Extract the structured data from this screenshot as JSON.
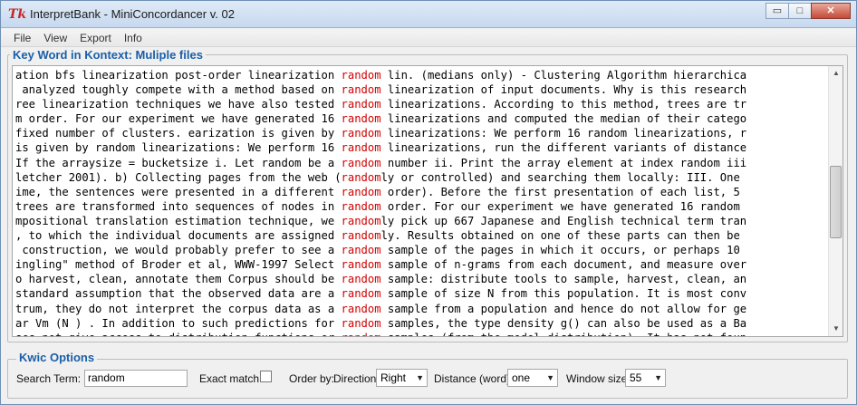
{
  "window": {
    "title": "InterpretBank - MiniConcordancer v. 02",
    "app_icon_glyph": "Tk",
    "controls": {
      "minimize": "▭",
      "maximize": "□",
      "close": "✕"
    }
  },
  "menu": [
    "File",
    "View",
    "Export",
    "Info"
  ],
  "kwic": {
    "title": "Key Word in Kontext: Muliple files",
    "keyword": "random",
    "lines": [
      {
        "left": "ation bfs linearization post-order linearization ",
        "kw": "random",
        "right": " lin. (medians only) - Clustering Algorithm hierarchica"
      },
      {
        "left": " analyzed toughly compete with a method based on ",
        "kw": "random",
        "right": " linearization of input documents. Why is this research"
      },
      {
        "left": "ree linearization techniques we have also tested ",
        "kw": "random",
        "right": " linearizations. According to this method, trees are tr"
      },
      {
        "left": "m order. For our experiment we have generated 16 ",
        "kw": "random",
        "right": " linearizations and computed the median of their catego"
      },
      {
        "left": "fixed number of clusters. earization is given by ",
        "kw": "random",
        "right": " linearizations: We perform 16 random linearizations, r"
      },
      {
        "left": "is given by random linearizations: We perform 16 ",
        "kw": "random",
        "right": " linearizations, run the different variants of distance"
      },
      {
        "left": "If the arraysize = bucketsize i. Let random be a ",
        "kw": "random",
        "right": " number ii. Print the array element at index random iii"
      },
      {
        "left": "letcher 2001). b) Collecting pages from the web (",
        "kw": "random",
        "right": "ly or controlled) and searching them locally: III. One"
      },
      {
        "left": "ime, the sentences were presented in a different ",
        "kw": "random",
        "right": " order). Before the first presentation of each list, 5"
      },
      {
        "left": "trees are transformed into sequences of nodes in ",
        "kw": "random",
        "right": " order. For our experiment we have generated 16 random"
      },
      {
        "left": "mpositional translation estimation technique, we ",
        "kw": "random",
        "right": "ly pick up 667 Japanese and English technical term tran"
      },
      {
        "left": ", to which the individual documents are assigned ",
        "kw": "random",
        "right": "ly. Results obtained on one of these parts can then be"
      },
      {
        "left": " construction, we would probably prefer to see a ",
        "kw": "random",
        "right": " sample of the pages in which it occurs, or perhaps 10"
      },
      {
        "left": "ingling\" method of Broder et al, WWW-1997 Select ",
        "kw": "random",
        "right": " sample of n-grams from each document, and measure over"
      },
      {
        "left": "o harvest, clean, annotate them Corpus should be ",
        "kw": "random",
        "right": " sample: distribute tools to sample, harvest, clean, an"
      },
      {
        "left": "standard assumption that the observed data are a ",
        "kw": "random",
        "right": " sample of size N from this population. It is most conv"
      },
      {
        "left": "trum, they do not interpret the corpus data as a ",
        "kw": "random",
        "right": " sample from a population and hence do not allow for ge"
      },
      {
        "left": "ar Vm (N ) . In addition to such predictions for ",
        "kw": "random",
        "right": " samples, the type density g() can also be used as a Ba"
      },
      {
        "left": "ses not give access to distribution functions or ",
        "kw": "random",
        "right": " samples (from the model distribution). It has not foun"
      }
    ],
    "scrollbar": {
      "up": "▲",
      "down": "▼"
    }
  },
  "options": {
    "title": "Kwic Options",
    "search_term_label": "Search Term:",
    "search_term_value": "random",
    "exact_match_label": "Exact match",
    "exact_match_checked": false,
    "order_by_label": "Order by:",
    "direction_label": "Direction",
    "direction_value": "Right",
    "distance_label": "Distance (word)",
    "distance_value": "one",
    "window_size_label": "Window size",
    "window_size_value": "55",
    "dropdown_arrow": "▼"
  }
}
